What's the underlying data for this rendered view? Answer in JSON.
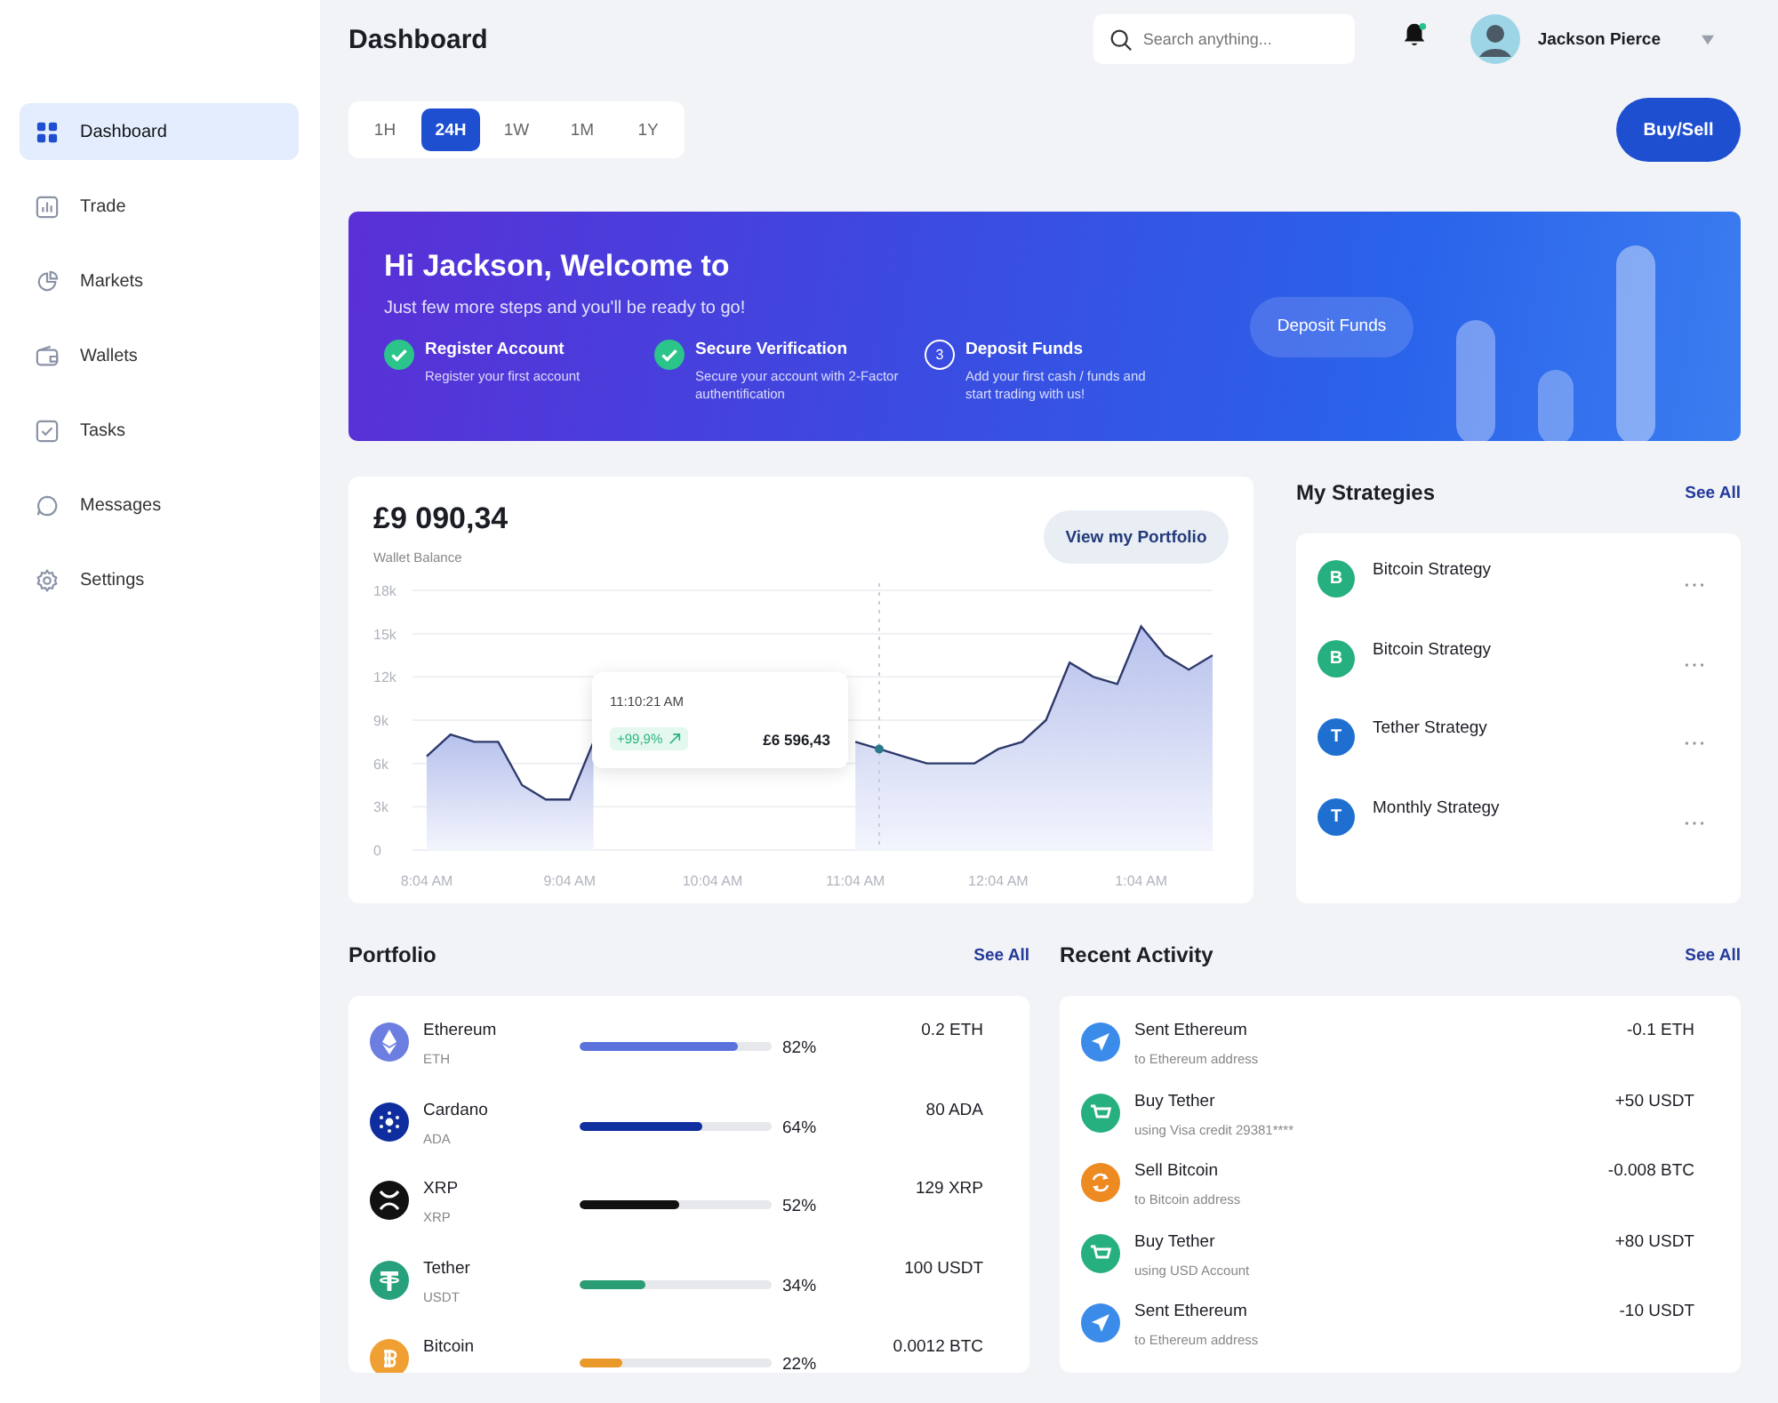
{
  "sidebar": {
    "items": [
      {
        "label": "Dashboard",
        "selected": true
      },
      {
        "label": "Trade",
        "selected": false
      },
      {
        "label": "Markets",
        "selected": false
      },
      {
        "label": "Wallets",
        "selected": false
      },
      {
        "label": "Tasks",
        "selected": false
      },
      {
        "label": "Messages",
        "selected": false
      },
      {
        "label": "Settings",
        "selected": false
      }
    ]
  },
  "header": {
    "title": "Dashboard",
    "search": {
      "placeholder": "Search anything..."
    },
    "notification_dot": true,
    "user_name": "Jackson Pierce"
  },
  "timeframes": [
    {
      "label": "1H",
      "selected": false
    },
    {
      "label": "24H",
      "selected": true
    },
    {
      "label": "1W",
      "selected": false
    },
    {
      "label": "1M",
      "selected": false
    },
    {
      "label": "1Y",
      "selected": false
    }
  ],
  "buy_sell_button": "Buy/Sell",
  "banner": {
    "title": "Hi Jackson, Welcome to",
    "subtitle": "Just few more steps and you'll be ready to go!",
    "steps": [
      {
        "title": "Register Account",
        "description": "Register your first account",
        "done": true
      },
      {
        "title": "Secure Verification",
        "description": "Secure your account with 2-Factor authentification",
        "done": true
      },
      {
        "title": "Deposit Funds",
        "description": "Add your first cash / funds and start trading with us!",
        "done": false,
        "number": "3"
      }
    ],
    "button": "Deposit Funds"
  },
  "wallet": {
    "balance": "£9 090,34",
    "label": "Wallet Balance",
    "button": "View my Portfolio",
    "chart_data": {
      "type": "area",
      "categories": [
        "8:04 AM",
        null,
        null,
        null,
        null,
        null,
        "9:04 AM",
        null,
        null,
        null,
        null,
        null,
        "10:04 AM",
        null,
        null,
        null,
        null,
        null,
        "11:04 AM",
        null,
        null,
        null,
        null,
        null,
        "12:04 AM",
        null,
        null,
        null,
        null,
        null,
        "1:04 AM",
        null,
        null,
        null
      ],
      "series": [
        {
          "color": "#2e3a6b",
          "values": [
            6500,
            8000,
            7500,
            7500,
            4500,
            3500,
            3500,
            7500,
            null,
            null,
            null,
            null,
            null,
            null,
            null,
            null,
            null,
            null,
            7500,
            7000,
            6500,
            6000,
            6000,
            6000,
            7000,
            7500,
            9000,
            13000,
            12000,
            11500,
            15500,
            13500,
            12500,
            13500
          ]
        }
      ],
      "ylim": [
        0,
        18000
      ],
      "grid": true,
      "yticks": [
        {
          "value": 0,
          "label": "0"
        },
        {
          "value": 3000,
          "label": "3k"
        },
        {
          "value": 6000,
          "label": "6k"
        },
        {
          "value": 9000,
          "label": "9k"
        },
        {
          "value": 12000,
          "label": "12k"
        },
        {
          "value": 15000,
          "label": "15k"
        },
        {
          "value": 18000,
          "label": "18k"
        }
      ]
    },
    "tooltip": {
      "time": "11:10:21 AM",
      "change": "+99,9%",
      "value": "£6 596,43"
    }
  },
  "strategies": {
    "title": "My Strategies",
    "see_all": "See All",
    "items": [
      {
        "letter": "B",
        "name": "Bitcoin Strategy",
        "color": "#27b07f"
      },
      {
        "letter": "B",
        "name": "Bitcoin Strategy",
        "color": "#27b07f"
      },
      {
        "letter": "T",
        "name": "Tether Strategy",
        "color": "#1f6fd1"
      },
      {
        "letter": "T",
        "name": "Monthly Strategy",
        "color": "#1f6fd1"
      }
    ]
  },
  "portfolio": {
    "title": "Portfolio",
    "see_all": "See All",
    "items": [
      {
        "name": "Ethereum",
        "symbol": "ETH",
        "level": 0.82,
        "percent": "82%",
        "amount": "0.2 ETH",
        "color": "#5b72dc"
      },
      {
        "name": "Cardano",
        "symbol": "ADA",
        "level": 0.64,
        "percent": "64%",
        "amount": "80 ADA",
        "color": "#10309f"
      },
      {
        "name": "XRP",
        "symbol": "XRP",
        "level": 0.52,
        "percent": "52%",
        "amount": "129 XRP",
        "color": "#111111"
      },
      {
        "name": "Tether",
        "symbol": "USDT",
        "level": 0.34,
        "percent": "34%",
        "amount": "100 USDT",
        "color": "#2a9d74"
      },
      {
        "name": "Bitcoin",
        "level": 0.22,
        "percent": "22%",
        "amount": "0.0012 BTC",
        "color": "#e9982a"
      }
    ]
  },
  "activity": {
    "title": "Recent Activity",
    "see_all": "See All",
    "items": [
      {
        "kind": "send",
        "title": "Sent Ethereum",
        "subtitle": "to Ethereum address",
        "amount": "-0.1 ETH"
      },
      {
        "kind": "buy",
        "title": "Buy Tether",
        "subtitle": "using Visa credit 29381****",
        "amount": "+50 USDT"
      },
      {
        "kind": "sell",
        "title": "Sell Bitcoin",
        "subtitle": "to Bitcoin address",
        "amount": "-0.008 BTC"
      },
      {
        "kind": "buy",
        "title": "Buy Tether",
        "subtitle": "using USD Account",
        "amount": "+80 USDT"
      },
      {
        "kind": "send",
        "title": "Sent Ethereum",
        "subtitle": "to Ethereum address",
        "amount": "-10 USDT"
      }
    ]
  }
}
